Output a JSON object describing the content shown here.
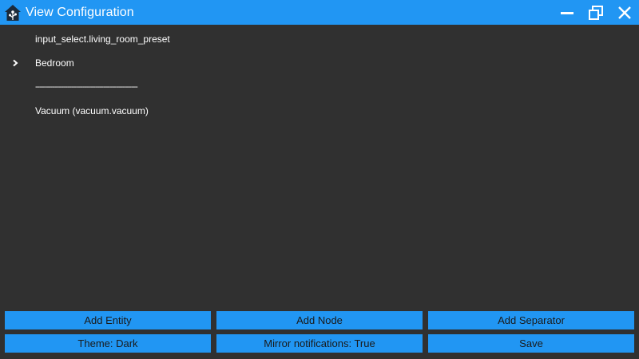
{
  "window": {
    "title": "View Configuration",
    "accent_color": "#2196f3",
    "background_color": "#303030",
    "controls": [
      "minimize-icon",
      "restore-icon",
      "close-icon"
    ]
  },
  "list": {
    "items": [
      {
        "label": "input_select.living_room_preset",
        "has_chevron": false
      },
      {
        "label": "Bedroom",
        "has_chevron": true
      },
      {
        "label": "------------------------------------------------",
        "has_chevron": false
      },
      {
        "label": "Vacuum (vacuum.vacuum)",
        "has_chevron": false
      }
    ]
  },
  "buttons": {
    "row1": {
      "add_entity": "Add Entity",
      "add_node": "Add Node",
      "add_separator": "Add Separator"
    },
    "row2": {
      "theme": "Theme: Dark",
      "mirror": "Mirror notifications: True",
      "save": "Save"
    }
  }
}
